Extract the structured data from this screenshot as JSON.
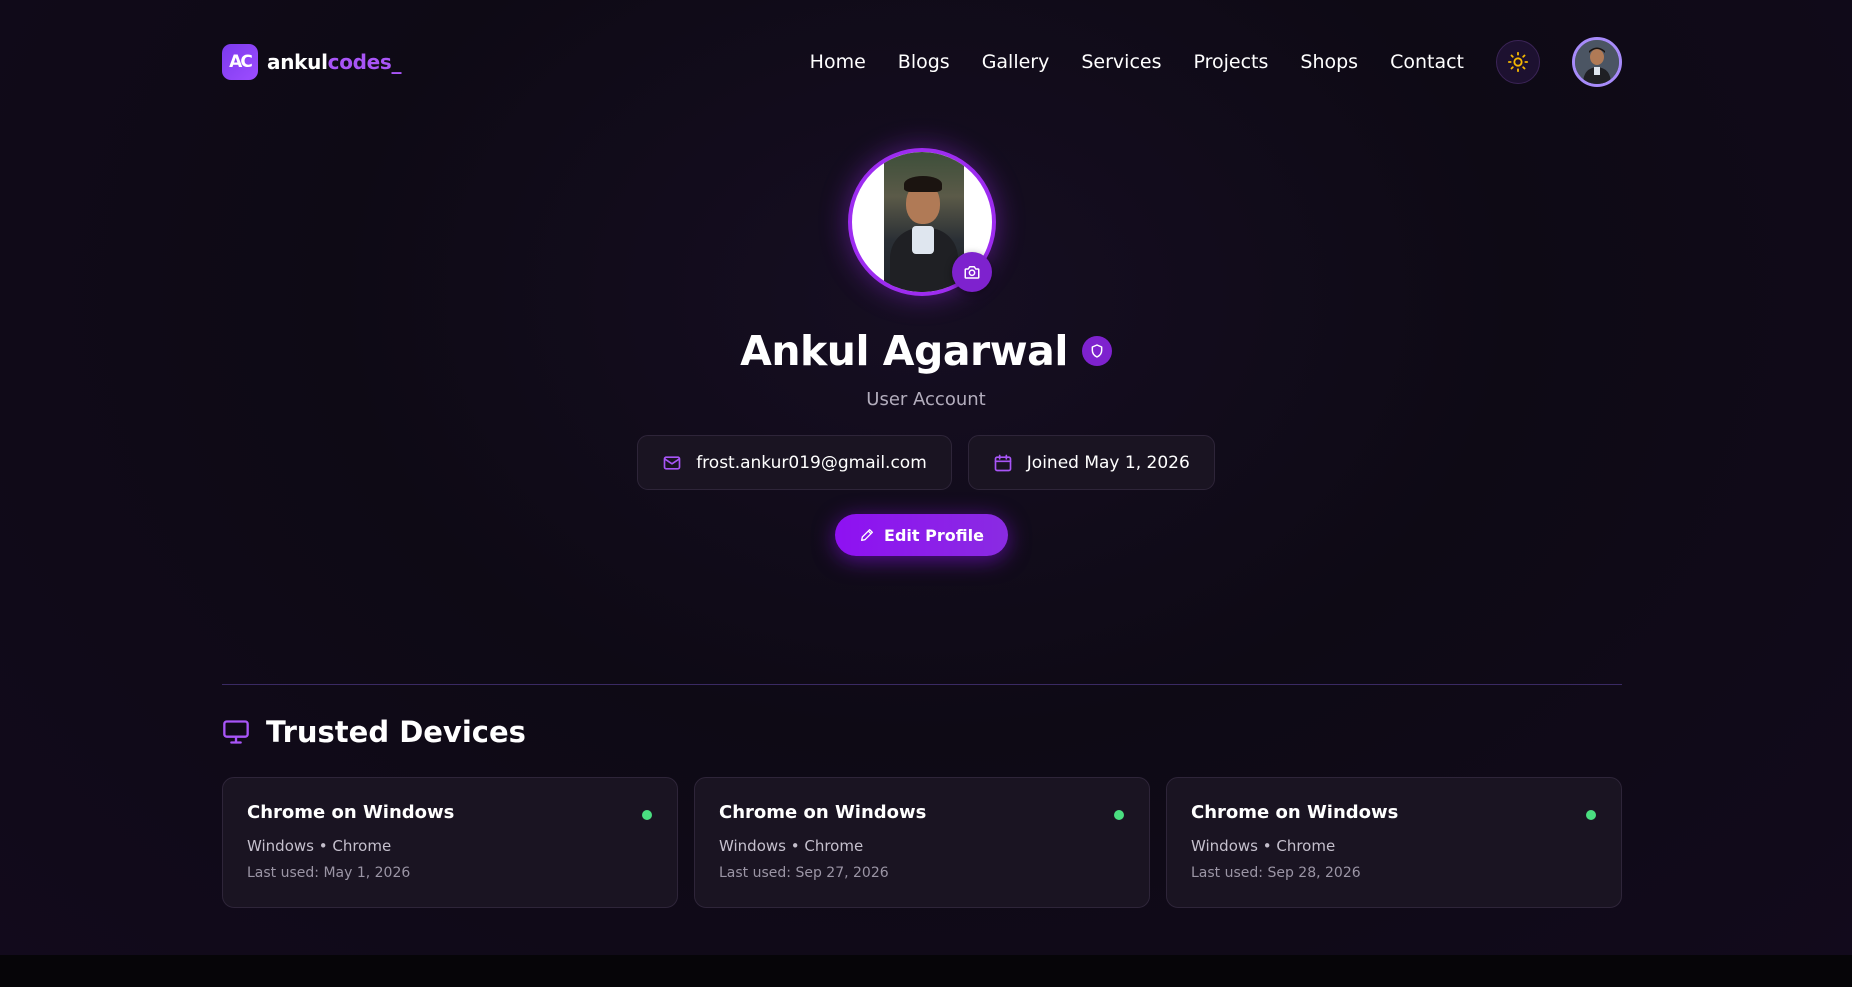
{
  "brand": {
    "logo_text": "AC",
    "name_part1": "ankul",
    "name_part2": "codes_"
  },
  "nav": {
    "links": [
      "Home",
      "Blogs",
      "Gallery",
      "Services",
      "Projects",
      "Shops",
      "Contact"
    ],
    "theme_icon": "sun-icon",
    "avatar_icon": "user-avatar"
  },
  "profile": {
    "name": "Ankul Agarwal",
    "role": "User Account",
    "email": "frost.ankur019@gmail.com",
    "joined": "Joined May 1, 2026",
    "edit_label": "Edit Profile",
    "verified_icon": "shield-icon",
    "camera_icon": "camera-icon"
  },
  "devices": {
    "title": "Trusted Devices",
    "icon": "monitor-icon",
    "items": [
      {
        "name": "Chrome on Windows",
        "meta": "Windows • Chrome",
        "last_used": "Last used: May 1, 2026",
        "status": "active"
      },
      {
        "name": "Chrome on Windows",
        "meta": "Windows • Chrome",
        "last_used": "Last used: Sep 27, 2026",
        "status": "active"
      },
      {
        "name": "Chrome on Windows",
        "meta": "Windows • Chrome",
        "last_used": "Last used: Sep 28, 2026",
        "status": "active"
      }
    ]
  },
  "colors": {
    "accent": "#9d2cf0",
    "background": "#0e0a15",
    "status_active": "#4ade80",
    "sun": "#f5b800"
  }
}
